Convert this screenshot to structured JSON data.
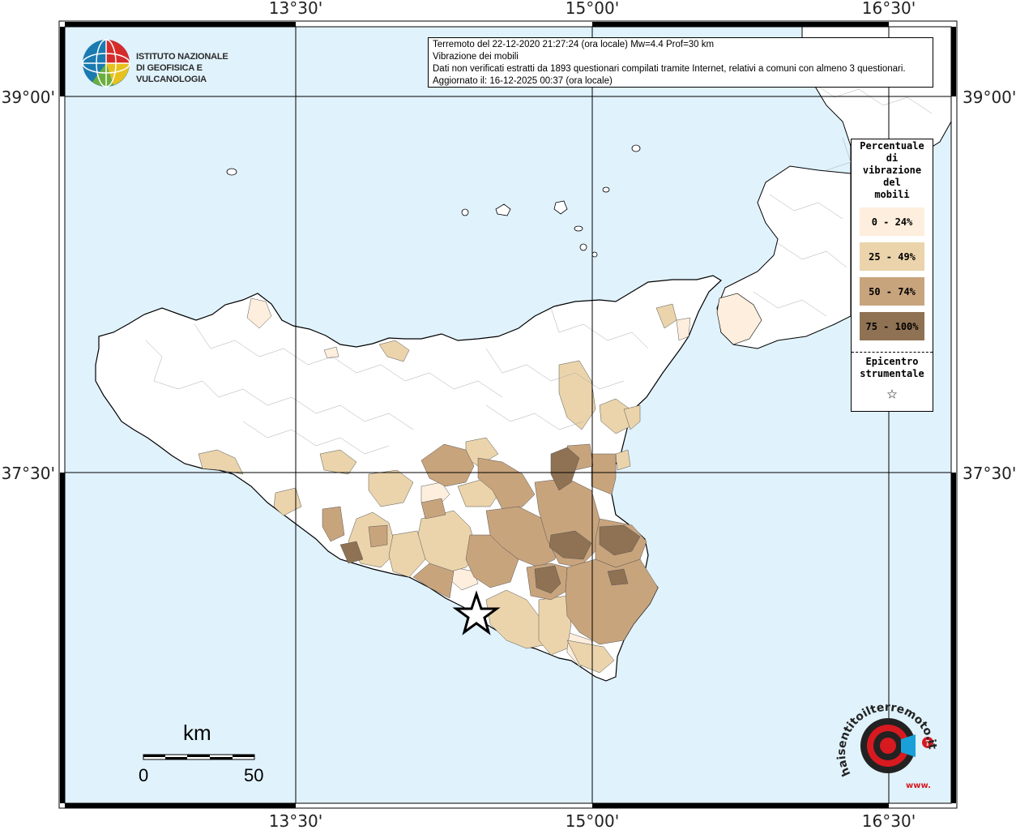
{
  "map": {
    "coords": {
      "lon_top": [
        "13°30'",
        "15°00'",
        "16°30'"
      ],
      "lon_bottom": [
        "13°30'",
        "15°00'",
        "16°30'"
      ],
      "lat_left": [
        "39°00'",
        "37°30'"
      ],
      "lat_right": [
        "39°00'",
        "37°30'"
      ]
    },
    "colors": {
      "sea": "#e0f2fc",
      "land": "#ffffff",
      "class_0": "#fdeedd",
      "class_1": "#ebd4ab",
      "class_2": "#c8a47d",
      "class_3": "#8f7253"
    }
  },
  "info": {
    "line1": "Terremoto del 22-12-2020 21:27:24 (ora locale) Mw=4.4 Prof=30 km",
    "line2": "Vibrazione dei mobili",
    "line3": "Dati non verificati estratti da 1893 questionari compilati tramite Internet, relativi a comuni con almeno 3 questionari.",
    "line4": "Aggiornato il: 16-12-2025 00:37 (ora locale)"
  },
  "logo": {
    "line1": "ISTITUTO NAZIONALE",
    "line2": "DI GEOFISICA E VULCANOLOGIA"
  },
  "legend": {
    "title_lines": [
      "Percentuale",
      "di",
      "vibrazione",
      "del",
      "mobili"
    ],
    "items": [
      {
        "label": "0 - 24%",
        "color": "#fdeedd"
      },
      {
        "label": "25 - 49%",
        "color": "#ebd4ab"
      },
      {
        "label": "50 - 74%",
        "color": "#c8a47d"
      },
      {
        "label": "75 - 100%",
        "color": "#8f7253"
      }
    ],
    "epicenter_line1": "Epicentro",
    "epicenter_line2": "strumentale",
    "star_glyph": "☆"
  },
  "scale": {
    "unit": "km",
    "min": "0",
    "max": "50"
  },
  "badge": {
    "text": "haisentitoilterremoto.it",
    "prefix": "www."
  }
}
